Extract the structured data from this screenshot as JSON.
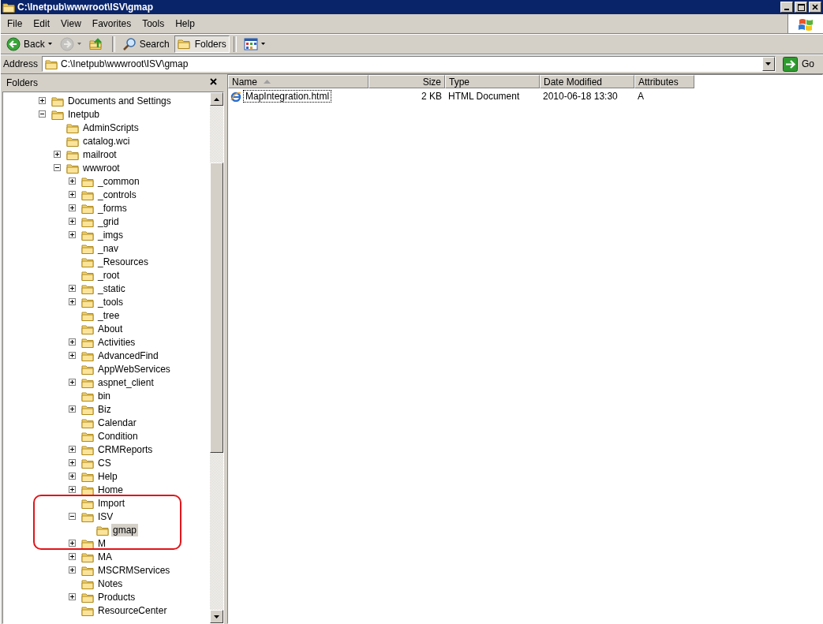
{
  "window": {
    "title": "C:\\Inetpub\\wwwroot\\ISV\\gmap"
  },
  "menu": [
    {
      "label": "File"
    },
    {
      "label": "Edit"
    },
    {
      "label": "View"
    },
    {
      "label": "Favorites"
    },
    {
      "label": "Tools"
    },
    {
      "label": "Help"
    }
  ],
  "toolbar": [
    {
      "kind": "back",
      "label": "Back",
      "disabled": false,
      "selected": false
    },
    {
      "kind": "forward",
      "disabled": true,
      "selected": false
    },
    {
      "kind": "up",
      "disabled": false,
      "selected": false
    },
    {
      "kind": "search",
      "label": "Search",
      "disabled": false,
      "selected": false
    },
    {
      "kind": "folders",
      "label": "Folders",
      "disabled": false,
      "selected": true
    },
    {
      "kind": "views",
      "disabled": false,
      "selected": false
    }
  ],
  "address": {
    "label": "Address",
    "value": "C:\\Inetpub\\wwwroot\\ISV\\gmap",
    "go_label": "Go"
  },
  "folders_pane": {
    "title": "Folders",
    "highlight_annotation": true,
    "tree": [
      {
        "label": "Documents and Settings",
        "expanded": false,
        "selected": false
      },
      {
        "label": "Inetpub",
        "expanded": true,
        "selected": false,
        "children": [
          {
            "label": "AdminScripts",
            "selected": false
          },
          {
            "label": "catalog.wci",
            "selected": false
          },
          {
            "label": "mailroot",
            "expanded": false,
            "selected": false
          },
          {
            "label": "wwwroot",
            "expanded": true,
            "selected": false,
            "children": [
              {
                "label": "_common",
                "expanded": false,
                "selected": false
              },
              {
                "label": "_controls",
                "expanded": false,
                "selected": false
              },
              {
                "label": "_forms",
                "expanded": false,
                "selected": false
              },
              {
                "label": "_grid",
                "expanded": false,
                "selected": false
              },
              {
                "label": "_imgs",
                "expanded": false,
                "selected": false
              },
              {
                "label": "_nav",
                "selected": false
              },
              {
                "label": "_Resources",
                "selected": false
              },
              {
                "label": "_root",
                "selected": false
              },
              {
                "label": "_static",
                "expanded": false,
                "selected": false
              },
              {
                "label": "_tools",
                "expanded": false,
                "selected": false
              },
              {
                "label": "_tree",
                "selected": false
              },
              {
                "label": "About",
                "selected": false
              },
              {
                "label": "Activities",
                "expanded": false,
                "selected": false
              },
              {
                "label": "AdvancedFind",
                "expanded": false,
                "selected": false
              },
              {
                "label": "AppWebServices",
                "selected": false
              },
              {
                "label": "aspnet_client",
                "expanded": false,
                "selected": false
              },
              {
                "label": "bin",
                "selected": false
              },
              {
                "label": "Biz",
                "expanded": false,
                "selected": false
              },
              {
                "label": "Calendar",
                "selected": false
              },
              {
                "label": "Condition",
                "selected": false
              },
              {
                "label": "CRMReports",
                "expanded": false,
                "selected": false
              },
              {
                "label": "CS",
                "expanded": false,
                "selected": false
              },
              {
                "label": "Help",
                "expanded": false,
                "selected": false
              },
              {
                "label": "Home",
                "expanded": false,
                "selected": false
              },
              {
                "label": "Import",
                "selected": false
              },
              {
                "label": "ISV",
                "expanded": true,
                "selected": false,
                "children": [
                  {
                    "label": "gmap",
                    "selected": true
                  }
                ]
              },
              {
                "label": "M",
                "expanded": false,
                "selected": false
              },
              {
                "label": "MA",
                "expanded": false,
                "selected": false
              },
              {
                "label": "MSCRMServices",
                "expanded": false,
                "selected": false
              },
              {
                "label": "Notes",
                "selected": false
              },
              {
                "label": "Products",
                "expanded": false,
                "selected": false
              },
              {
                "label": "ResourceCenter",
                "selected": false
              }
            ]
          }
        ]
      }
    ]
  },
  "file_list": {
    "columns": [
      {
        "label": "Name",
        "sorted": true
      },
      {
        "label": "Size",
        "sorted": false
      },
      {
        "label": "Type",
        "sorted": false
      },
      {
        "label": "Date Modified",
        "sorted": false
      },
      {
        "label": "Attributes",
        "sorted": false
      }
    ],
    "rows": [
      {
        "cells": [
          "MapIntegration.html",
          "2 KB",
          "HTML Document",
          "2010-06-18 13:30",
          "A"
        ],
        "focused": true
      }
    ]
  }
}
